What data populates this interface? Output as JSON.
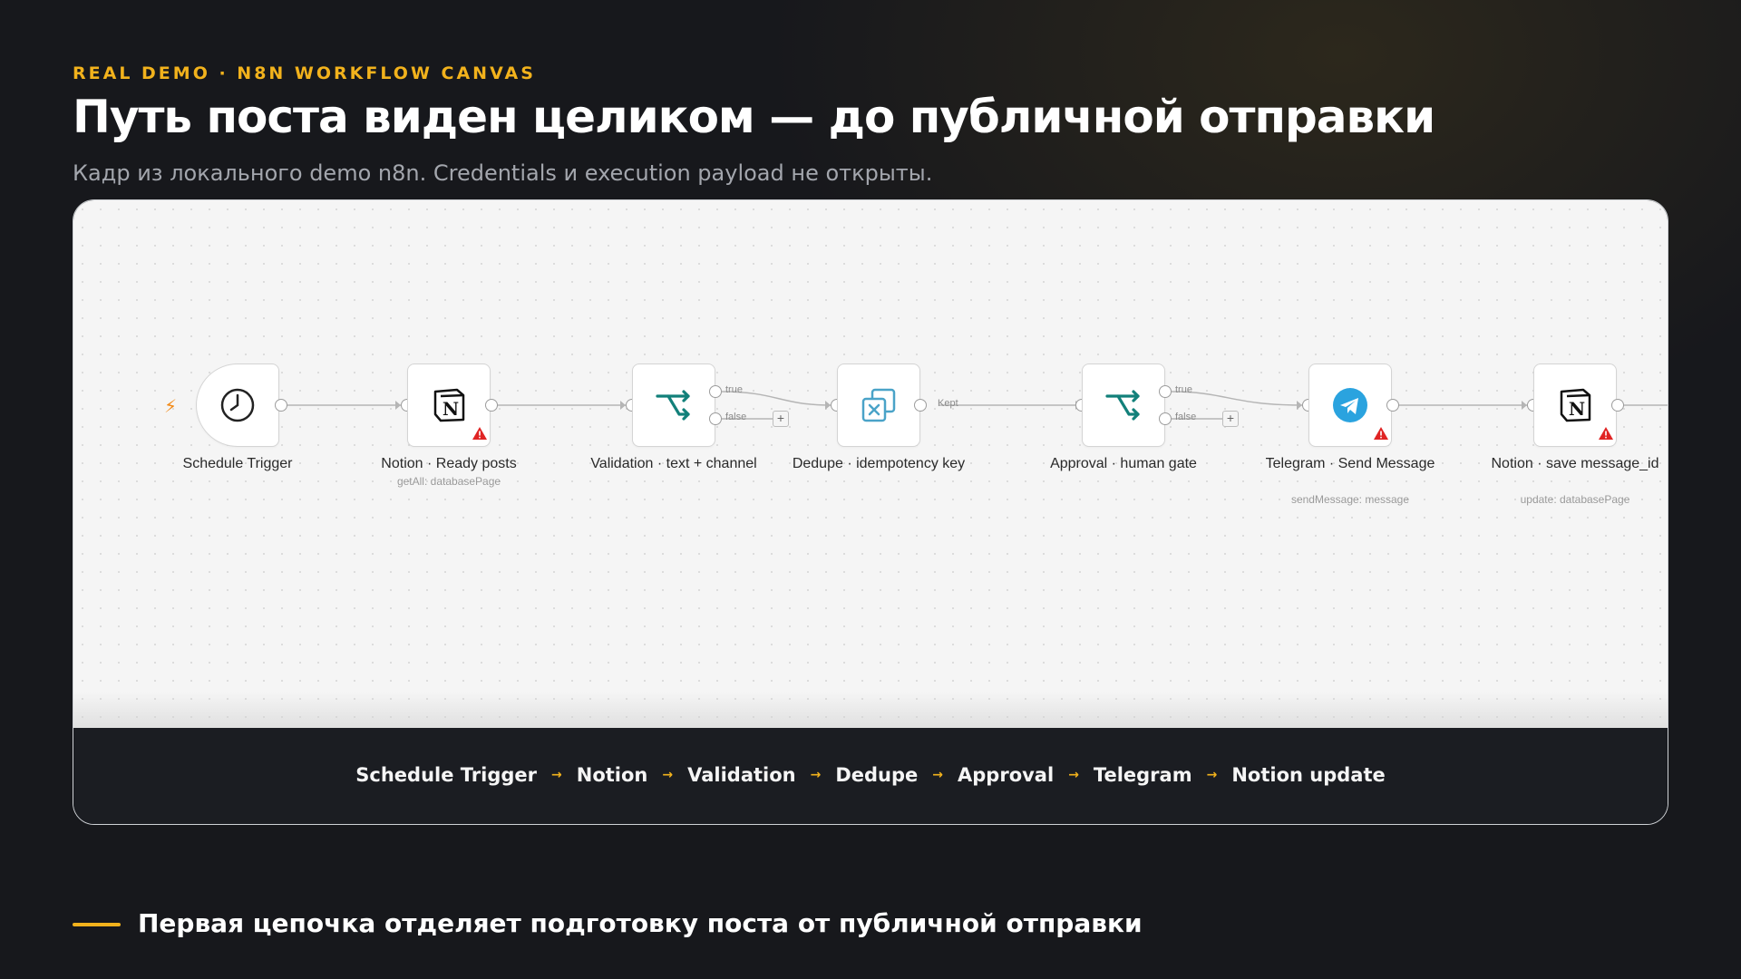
{
  "header": {
    "eyebrow": "REAL DEMO · N8N WORKFLOW CANVAS",
    "title": "Путь поста виден целиком — до публичной отправки",
    "subtitle": "Кадр из локального demo n8n. Credentials и execution payload не открыты."
  },
  "workflow": {
    "nodes": [
      {
        "label": "Schedule Trigger",
        "sub": "",
        "icon": "clock-icon"
      },
      {
        "label": "Notion · Ready posts",
        "sub": "getAll: databasePage",
        "icon": "notion-icon",
        "warning": true
      },
      {
        "label": "Validation · text + channel",
        "sub": "",
        "icon": "if-icon",
        "branches": [
          "true",
          "false"
        ]
      },
      {
        "label": "Dedupe · idempotency key",
        "sub": "",
        "icon": "dedupe-icon",
        "output": "Kept"
      },
      {
        "label": "Approval · human gate",
        "sub": "",
        "icon": "if-icon",
        "branches": [
          "true",
          "false"
        ]
      },
      {
        "label": "Telegram · Send Message",
        "sub": "sendMessage: message",
        "icon": "telegram-icon",
        "warning": true
      },
      {
        "label": "Notion · save message_id",
        "sub": "update: databasePage",
        "icon": "notion-icon",
        "warning": true
      }
    ],
    "add_symbol": "+"
  },
  "chain": {
    "steps": [
      "Schedule Trigger",
      "Notion",
      "Validation",
      "Dedupe",
      "Approval",
      "Telegram",
      "Notion update"
    ],
    "arrow": "→"
  },
  "footer": {
    "caption": "Первая цепочка отделяет подготовку поста от публичной отправки"
  },
  "colors": {
    "accent": "#f2b21c",
    "background": "#17181c",
    "canvas": "#f5f5f5",
    "teal": "#12807a",
    "telegram": "#2aa3df",
    "warning": "#e02424"
  }
}
